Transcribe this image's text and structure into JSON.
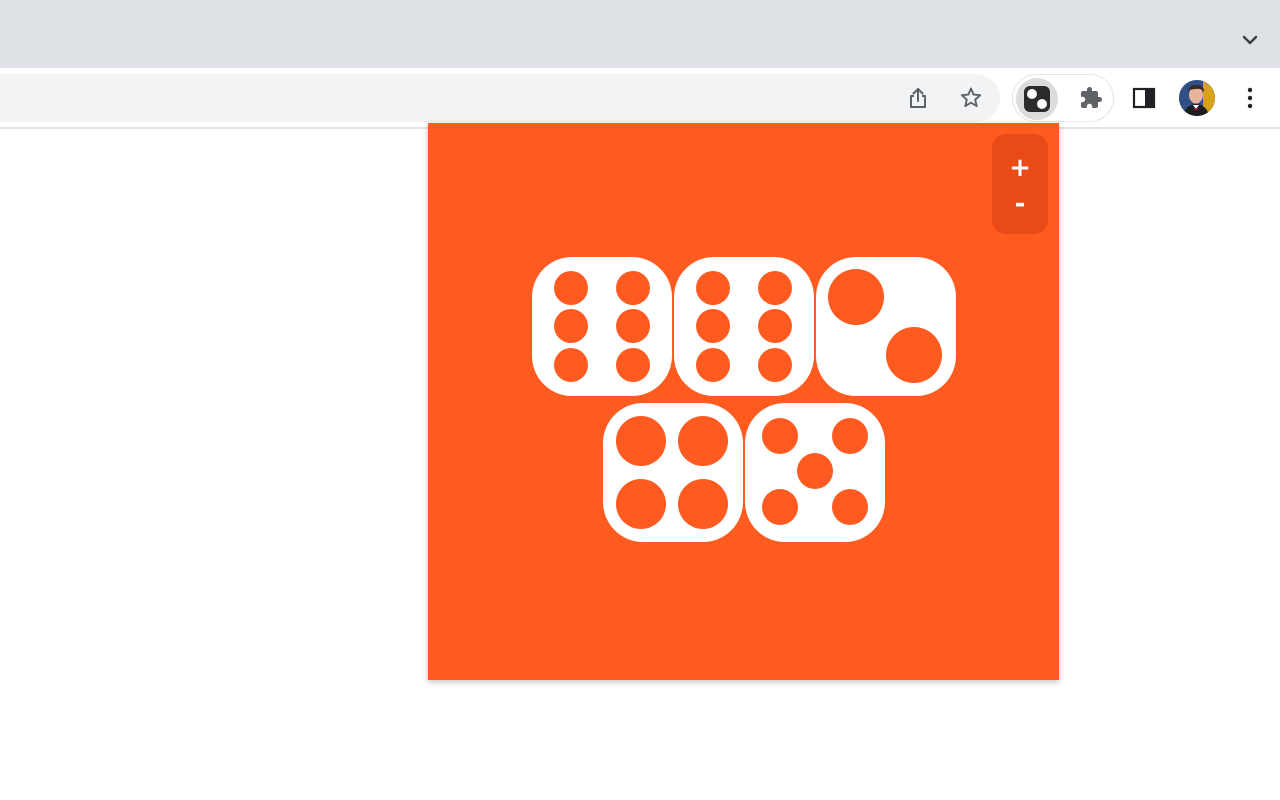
{
  "browser": {
    "tab_menu_icon": "chevron-down-icon",
    "toolbar_icons": [
      "share-icon",
      "bookmark-star-icon",
      "dice-extension-icon",
      "puzzle-extensions-icon",
      "side-panel-icon",
      "profile-avatar",
      "more-vert-icon"
    ]
  },
  "popup": {
    "background": "#ff5a1f",
    "zoom_in_label": "+",
    "zoom_out_label": "-",
    "dice_values": [
      6,
      6,
      2,
      4,
      5
    ]
  }
}
